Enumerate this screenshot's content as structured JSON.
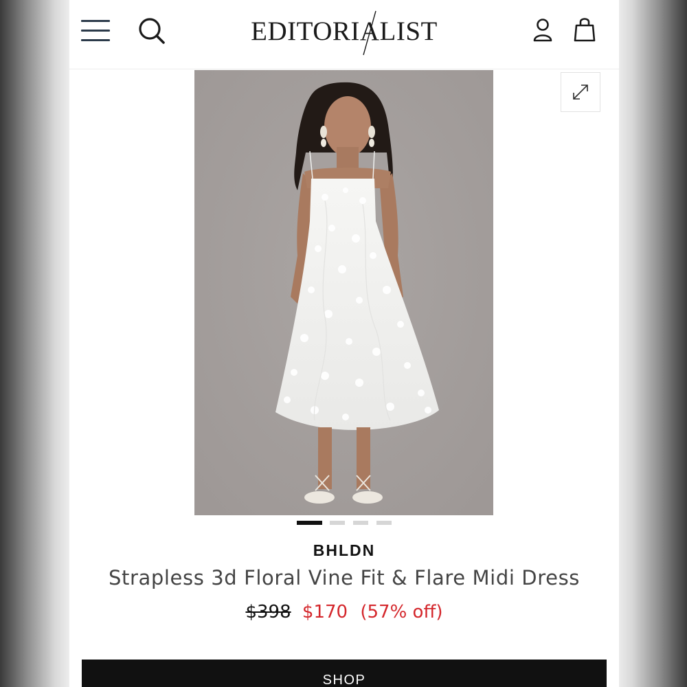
{
  "header": {
    "logo_text": "EDITORIALIST",
    "menu_icon": "hamburger-menu-icon",
    "search_icon": "search-icon",
    "account_icon": "user-icon",
    "bag_icon": "shopping-bag-icon",
    "icon_color": "#2b3a4a"
  },
  "gallery": {
    "expand_icon": "expand-icon",
    "image_count": 4,
    "active_index": 0,
    "active_dot_color": "#111111",
    "inactive_dot_color": "#d6d6d6"
  },
  "product": {
    "brand": "BHLDN",
    "name": "Strapless 3d Floral Vine Fit & Flare Midi Dress",
    "price_original": "$398",
    "price_sale": "$170",
    "discount": "(57% off)",
    "sale_color": "#d4262b"
  },
  "actions": {
    "shop_label": "SHOP"
  }
}
